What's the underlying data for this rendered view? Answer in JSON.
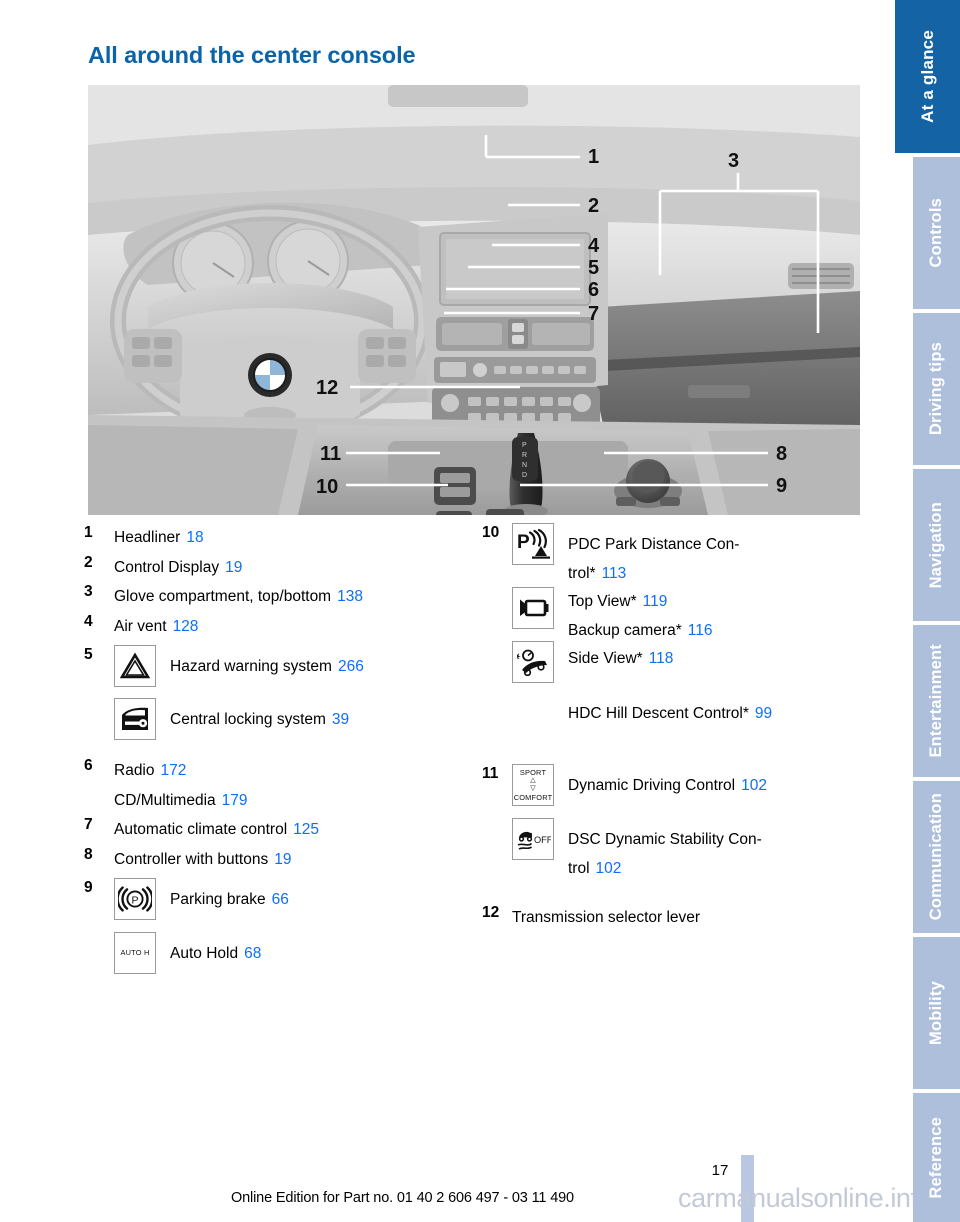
{
  "page": {
    "title": "All around the center console",
    "number": "17",
    "footer": "Online Edition for Part no. 01 40 2 606 497 - 03 11 490",
    "watermark": "carmanualsonline.info"
  },
  "colors": {
    "title_blue": "#0b63a8",
    "link_blue": "#0d6efd",
    "tab_active": "#1463a5",
    "tab_inactive": "#aebfdc",
    "page_bar": "#b9c7e2"
  },
  "sidebar": {
    "tabs": [
      {
        "label": "At a glance",
        "active": true
      },
      {
        "label": "Controls",
        "active": false
      },
      {
        "label": "Driving tips",
        "active": false
      },
      {
        "label": "Navigation",
        "active": false
      },
      {
        "label": "Entertainment",
        "active": false
      },
      {
        "label": "Communication",
        "active": false
      },
      {
        "label": "Mobility",
        "active": false
      },
      {
        "label": "Reference",
        "active": false
      }
    ]
  },
  "figure": {
    "alt": "Grayscale illustration of BMW dashboard and center console with numbered callouts",
    "callouts": [
      "1",
      "2",
      "3",
      "4",
      "5",
      "6",
      "7",
      "8",
      "9",
      "10",
      "11",
      "12"
    ]
  },
  "legend_left": [
    {
      "num": "1",
      "icon": null,
      "label": "Headliner",
      "page": "18"
    },
    {
      "num": "2",
      "icon": null,
      "label": "Control Display",
      "page": "19"
    },
    {
      "num": "3",
      "icon": null,
      "label": "Glove compartment, top/bottom",
      "page": "138"
    },
    {
      "num": "4",
      "icon": null,
      "label": "Air vent",
      "page": "128"
    },
    {
      "num": "5",
      "icon": "hazard-warning-icon",
      "label": "Hazard warning system",
      "page": "266"
    },
    {
      "num": "",
      "icon": "central-locking-icon",
      "label": "Central locking system",
      "page": "39"
    },
    {
      "num": "6",
      "icon": null,
      "label": "Radio",
      "page": "172"
    },
    {
      "num": "",
      "icon": null,
      "label": "CD/Multimedia",
      "page": "179"
    },
    {
      "num": "7",
      "icon": null,
      "label": "Automatic climate control",
      "page": "125"
    },
    {
      "num": "8",
      "icon": null,
      "label": "Controller with buttons",
      "page": "19"
    },
    {
      "num": "9",
      "icon": "parking-brake-icon",
      "label": "Parking brake",
      "page": "66"
    },
    {
      "num": "",
      "icon": "auto-hold-icon",
      "label": "Auto Hold",
      "page": "68"
    }
  ],
  "legend_right": [
    {
      "num": "10",
      "icon": "pdc-icon",
      "label": "PDC Park Distance Con-\ntrol*",
      "page": "113"
    },
    {
      "num": "",
      "icon": null,
      "label": "Top View*",
      "page": "119"
    },
    {
      "num": "",
      "icon": null,
      "label": "Backup camera*",
      "page": "116"
    },
    {
      "num": "",
      "icon": "side-view-camera-icon",
      "label": "Side View*",
      "page": "118"
    },
    {
      "num": "",
      "icon": "hdc-icon",
      "label": "HDC Hill Descent Control*",
      "page": "99"
    },
    {
      "num": "11",
      "icon": "sport-comfort-icon",
      "label": "Dynamic Driving Control",
      "page": "102"
    },
    {
      "num": "",
      "icon": "dsc-off-icon",
      "label": "DSC Dynamic Stability Con-\ntrol",
      "page": "102"
    },
    {
      "num": "12",
      "icon": null,
      "label": "Transmission selector lever",
      "page": ""
    }
  ],
  "icon_text": {
    "sport": "SPORT",
    "comfort": "COMFORT",
    "auto_hold": "AUTO H",
    "off": "OFF",
    "p": "P"
  }
}
